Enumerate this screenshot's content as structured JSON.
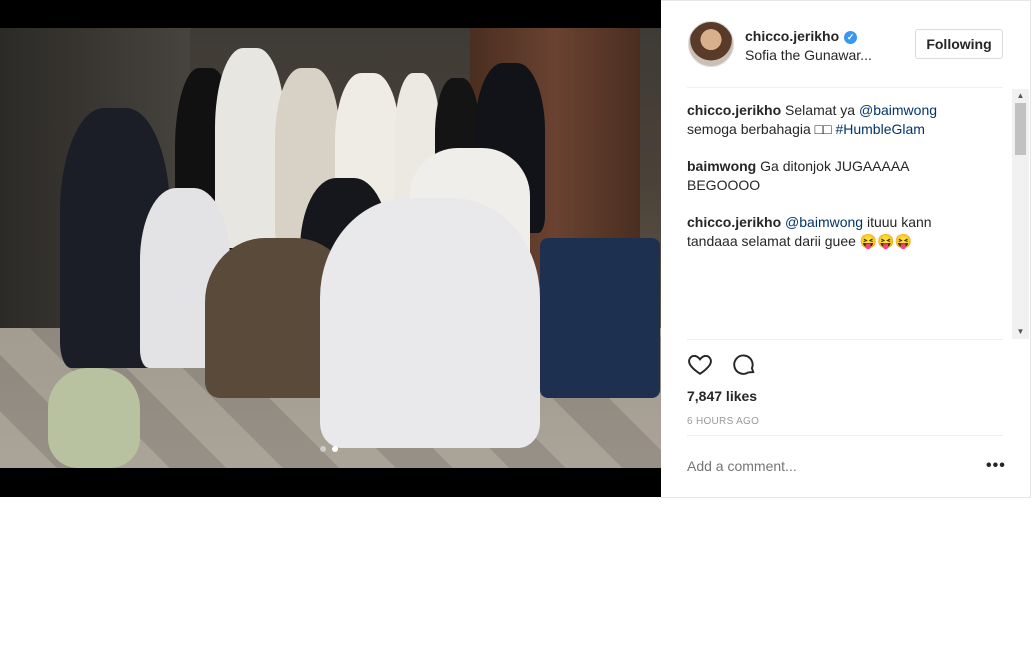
{
  "post": {
    "username": "chicco.jerikho",
    "location": "Sofia the Gunawar...",
    "follow_label": "Following",
    "comments": [
      {
        "author": "chicco.jerikho",
        "parts": [
          {
            "t": " Selamat ya "
          },
          {
            "t": "@baimwong",
            "tag": true
          },
          {
            "t": " semoga berbahagia □□ "
          },
          {
            "t": "#HumbleGlam",
            "tag": true
          }
        ]
      },
      {
        "author": "baimwong",
        "parts": [
          {
            "t": " Ga ditonjok JUGAAAAA BEGOOOO"
          }
        ]
      },
      {
        "author": "chicco.jerikho",
        "parts": [
          {
            "t": " "
          },
          {
            "t": "@baimwong",
            "tag": true
          },
          {
            "t": " ituuu kann tandaaa selamat darii guee 😝😝😝"
          }
        ]
      }
    ],
    "likes": "7,847 likes",
    "time": "6 HOURS AGO",
    "comment_placeholder": "Add a comment...",
    "more_label": "•••",
    "carousel": {
      "count": 2,
      "active": 1
    }
  },
  "icons": {
    "like": "heart-icon",
    "comment": "comment-bubble-icon",
    "verified": "verified-badge-icon",
    "more": "more-options-icon"
  },
  "colors": {
    "link": "#003569",
    "verified": "#3897f0",
    "muted": "#999999",
    "border": "#dbdbdb"
  }
}
